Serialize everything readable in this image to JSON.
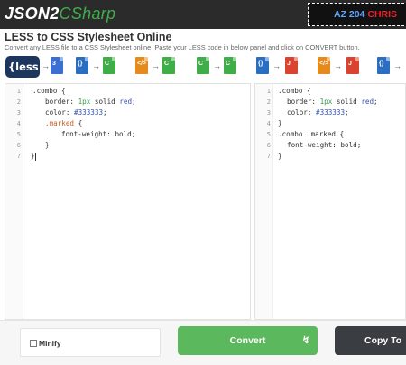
{
  "header": {
    "logo_part1": "JSON2",
    "logo_part2": "CSharp",
    "promo_part1": "AZ 204",
    "promo_part2": "CHRIS"
  },
  "page": {
    "title": "LESS to CSS Stylesheet Online",
    "subtitle": "Convert any LESS file to a CSS Stylesheet online. Paste your LESS code in below panel and click on CONVERT button."
  },
  "icon_strip": {
    "less_badge": "{less}",
    "labels": {
      "json": "JSON",
      "xml": "XML",
      "java": "JAVA"
    }
  },
  "left_editor": {
    "line_numbers": [
      "1",
      "2",
      "3",
      "4",
      "5",
      "6",
      "7"
    ],
    "code": {
      "l1": ".combo {",
      "l2_prop": "border: ",
      "l2_val1": "1px",
      "l2_val2": " solid ",
      "l2_val3": "red",
      "l2_end": ";",
      "l3_prop": "color: ",
      "l3_val": "#333333",
      "l3_end": ";",
      "l4_sel": ".marked",
      "l4_brace": " {",
      "l5_prop": "font-weight: ",
      "l5_val": "bold",
      "l5_end": ";",
      "l6": "}",
      "l7": "}"
    }
  },
  "right_editor": {
    "line_numbers": [
      "1",
      "2",
      "3",
      "4",
      "5",
      "6",
      "7"
    ],
    "code": {
      "l1": ".combo {",
      "l2_prop": "border: ",
      "l2_val1": "1px",
      "l2_val2": " solid ",
      "l2_val3": "red",
      "l2_end": ";",
      "l3_prop": "color: ",
      "l3_val": "#333333",
      "l3_end": ";",
      "l4": "}",
      "l5": ".combo .marked {",
      "l6_prop": "font-weight: ",
      "l6_val": "bold",
      "l6_end": ";",
      "l7": "}"
    }
  },
  "footer": {
    "minify_label": "Minify",
    "convert_label": "Convert",
    "copy_label": "Copy To"
  },
  "colors": {
    "convert_green": "#5cb85c",
    "copy_dark": "#3a3d41",
    "header_bg": "#2b2b2b",
    "logo_green": "#3fae49"
  }
}
